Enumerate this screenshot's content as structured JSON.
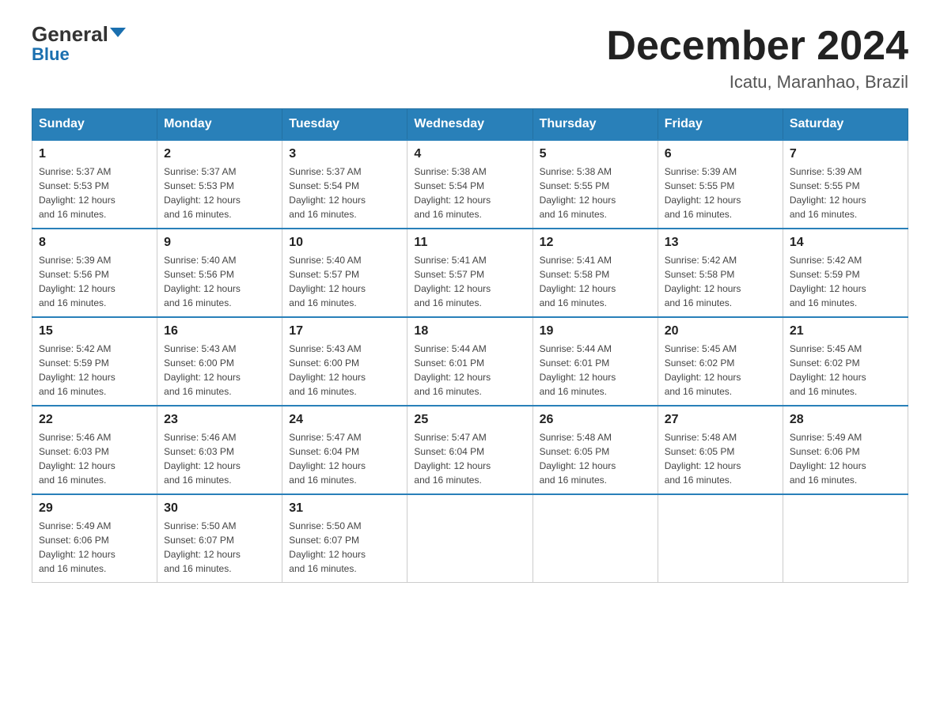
{
  "header": {
    "logo_line1": "General",
    "logo_line2": "Blue",
    "month_title": "December 2024",
    "subtitle": "Icatu, Maranhao, Brazil"
  },
  "weekdays": [
    "Sunday",
    "Monday",
    "Tuesday",
    "Wednesday",
    "Thursday",
    "Friday",
    "Saturday"
  ],
  "weeks": [
    [
      {
        "day": "1",
        "info": "Sunrise: 5:37 AM\nSunset: 5:53 PM\nDaylight: 12 hours\nand 16 minutes."
      },
      {
        "day": "2",
        "info": "Sunrise: 5:37 AM\nSunset: 5:53 PM\nDaylight: 12 hours\nand 16 minutes."
      },
      {
        "day": "3",
        "info": "Sunrise: 5:37 AM\nSunset: 5:54 PM\nDaylight: 12 hours\nand 16 minutes."
      },
      {
        "day": "4",
        "info": "Sunrise: 5:38 AM\nSunset: 5:54 PM\nDaylight: 12 hours\nand 16 minutes."
      },
      {
        "day": "5",
        "info": "Sunrise: 5:38 AM\nSunset: 5:55 PM\nDaylight: 12 hours\nand 16 minutes."
      },
      {
        "day": "6",
        "info": "Sunrise: 5:39 AM\nSunset: 5:55 PM\nDaylight: 12 hours\nand 16 minutes."
      },
      {
        "day": "7",
        "info": "Sunrise: 5:39 AM\nSunset: 5:55 PM\nDaylight: 12 hours\nand 16 minutes."
      }
    ],
    [
      {
        "day": "8",
        "info": "Sunrise: 5:39 AM\nSunset: 5:56 PM\nDaylight: 12 hours\nand 16 minutes."
      },
      {
        "day": "9",
        "info": "Sunrise: 5:40 AM\nSunset: 5:56 PM\nDaylight: 12 hours\nand 16 minutes."
      },
      {
        "day": "10",
        "info": "Sunrise: 5:40 AM\nSunset: 5:57 PM\nDaylight: 12 hours\nand 16 minutes."
      },
      {
        "day": "11",
        "info": "Sunrise: 5:41 AM\nSunset: 5:57 PM\nDaylight: 12 hours\nand 16 minutes."
      },
      {
        "day": "12",
        "info": "Sunrise: 5:41 AM\nSunset: 5:58 PM\nDaylight: 12 hours\nand 16 minutes."
      },
      {
        "day": "13",
        "info": "Sunrise: 5:42 AM\nSunset: 5:58 PM\nDaylight: 12 hours\nand 16 minutes."
      },
      {
        "day": "14",
        "info": "Sunrise: 5:42 AM\nSunset: 5:59 PM\nDaylight: 12 hours\nand 16 minutes."
      }
    ],
    [
      {
        "day": "15",
        "info": "Sunrise: 5:42 AM\nSunset: 5:59 PM\nDaylight: 12 hours\nand 16 minutes."
      },
      {
        "day": "16",
        "info": "Sunrise: 5:43 AM\nSunset: 6:00 PM\nDaylight: 12 hours\nand 16 minutes."
      },
      {
        "day": "17",
        "info": "Sunrise: 5:43 AM\nSunset: 6:00 PM\nDaylight: 12 hours\nand 16 minutes."
      },
      {
        "day": "18",
        "info": "Sunrise: 5:44 AM\nSunset: 6:01 PM\nDaylight: 12 hours\nand 16 minutes."
      },
      {
        "day": "19",
        "info": "Sunrise: 5:44 AM\nSunset: 6:01 PM\nDaylight: 12 hours\nand 16 minutes."
      },
      {
        "day": "20",
        "info": "Sunrise: 5:45 AM\nSunset: 6:02 PM\nDaylight: 12 hours\nand 16 minutes."
      },
      {
        "day": "21",
        "info": "Sunrise: 5:45 AM\nSunset: 6:02 PM\nDaylight: 12 hours\nand 16 minutes."
      }
    ],
    [
      {
        "day": "22",
        "info": "Sunrise: 5:46 AM\nSunset: 6:03 PM\nDaylight: 12 hours\nand 16 minutes."
      },
      {
        "day": "23",
        "info": "Sunrise: 5:46 AM\nSunset: 6:03 PM\nDaylight: 12 hours\nand 16 minutes."
      },
      {
        "day": "24",
        "info": "Sunrise: 5:47 AM\nSunset: 6:04 PM\nDaylight: 12 hours\nand 16 minutes."
      },
      {
        "day": "25",
        "info": "Sunrise: 5:47 AM\nSunset: 6:04 PM\nDaylight: 12 hours\nand 16 minutes."
      },
      {
        "day": "26",
        "info": "Sunrise: 5:48 AM\nSunset: 6:05 PM\nDaylight: 12 hours\nand 16 minutes."
      },
      {
        "day": "27",
        "info": "Sunrise: 5:48 AM\nSunset: 6:05 PM\nDaylight: 12 hours\nand 16 minutes."
      },
      {
        "day": "28",
        "info": "Sunrise: 5:49 AM\nSunset: 6:06 PM\nDaylight: 12 hours\nand 16 minutes."
      }
    ],
    [
      {
        "day": "29",
        "info": "Sunrise: 5:49 AM\nSunset: 6:06 PM\nDaylight: 12 hours\nand 16 minutes."
      },
      {
        "day": "30",
        "info": "Sunrise: 5:50 AM\nSunset: 6:07 PM\nDaylight: 12 hours\nand 16 minutes."
      },
      {
        "day": "31",
        "info": "Sunrise: 5:50 AM\nSunset: 6:07 PM\nDaylight: 12 hours\nand 16 minutes."
      },
      {
        "day": "",
        "info": ""
      },
      {
        "day": "",
        "info": ""
      },
      {
        "day": "",
        "info": ""
      },
      {
        "day": "",
        "info": ""
      }
    ]
  ]
}
